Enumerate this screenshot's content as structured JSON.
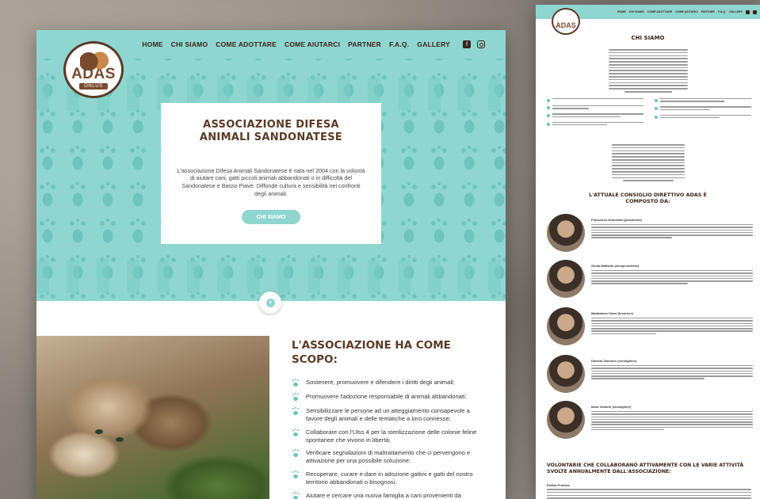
{
  "nav": {
    "items": [
      "HOME",
      "CHI SIAMO",
      "COME ADOTTARE",
      "COME AIUTARCI",
      "PARTNER",
      "F.A.Q.",
      "GALLERY"
    ],
    "social": [
      "facebook-icon",
      "instagram-icon"
    ]
  },
  "logo": {
    "main": "ADAS",
    "sub": "ONLUS"
  },
  "hero": {
    "title": "ASSOCIAZIONE DIFESA ANIMALI SANDONATESE",
    "text": "L'associazione Difesa Animali Sandonatese è nata nel 2004 con la volontà di aiutare cani, gatti piccoli animali abbandonati o in difficoltà del Sandonatese e Basso Piave. Diffonde cultura e sensibilità nei confronti degli animali.",
    "button": "CHI SIAMO"
  },
  "scope": {
    "title": "L'ASSOCIAZIONE HA COME SCOPO:",
    "items": [
      "Sostenere, promuovere e difendere i diritti degli animali;",
      "Promuovere l'adozione responsabile di animali abbandonati;",
      "Sensibilizzare le persone ad un atteggiamento consapevole a favore degli animali e delle tematiche a loro connesse;",
      "Collaborare con l'Ulss 4 per la sterilizzazione delle colonie feline spontanee che vivono in libertà;",
      "Verificare segnalazioni di maltrattamento che ci pervengono e attivazione per una possibile soluzione;",
      "Recuperare, curare e dare in adozione gattini e gatti del nostro territorio abbandonati o bisognosi;",
      "Aiutare e cercare una nuova famiglia a cani provenienti da"
    ]
  },
  "right_page": {
    "nav_items": [
      "HOME",
      "CHI SIAMO",
      "COME ADOTTARE",
      "COME AIUTARCI",
      "PARTNER",
      "F.A.Q.",
      "GALLERY"
    ],
    "logo": "ADAS",
    "heading1": "CHI SIAMO",
    "heading2": "L'ATTUALE CONSIGLIO DIRETTIVO ADAS È COMPOSTO DA:",
    "members": [
      "Francesco Granzotto (presidente)",
      "Giulia Mattiello (vicepresidente)",
      "Maddalena Omor (tesoriere)",
      "Daniela Zamuner (consigliere)",
      "Ilaria Vettorin (consigliere)"
    ],
    "heading3": "VOLONTARIE CHE COLLABORANO ATTIVAMENTE CON LE VARIE ATTIVITÀ SVOLTE ANNUALMENTE DALL'ASSOCIAZIONE:",
    "volunteer": "Elettra Probnor"
  },
  "colors": {
    "teal": "#8fd6d0",
    "teal_dark": "#6fc4bd",
    "brown": "#5a3a26",
    "brown_light": "#7a4a2e"
  }
}
